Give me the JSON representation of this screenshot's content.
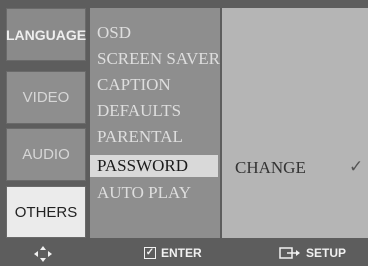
{
  "tabs": {
    "language": "LANGUAGE",
    "video": "VIDEO",
    "audio": "AUDIO",
    "others": "OTHERS"
  },
  "menu": {
    "items": [
      "OSD",
      "SCREEN SAVER",
      "CAPTION",
      "DEFAULTS",
      "PARENTAL",
      "PASSWORD",
      "AUTO PLAY"
    ],
    "selected": "PASSWORD"
  },
  "value": {
    "label": "CHANGE",
    "check_icon": "checkmark-icon"
  },
  "footer": {
    "enter_label": "ENTER",
    "setup_label": "SETUP",
    "nav_icon": "arrows-icon"
  }
}
